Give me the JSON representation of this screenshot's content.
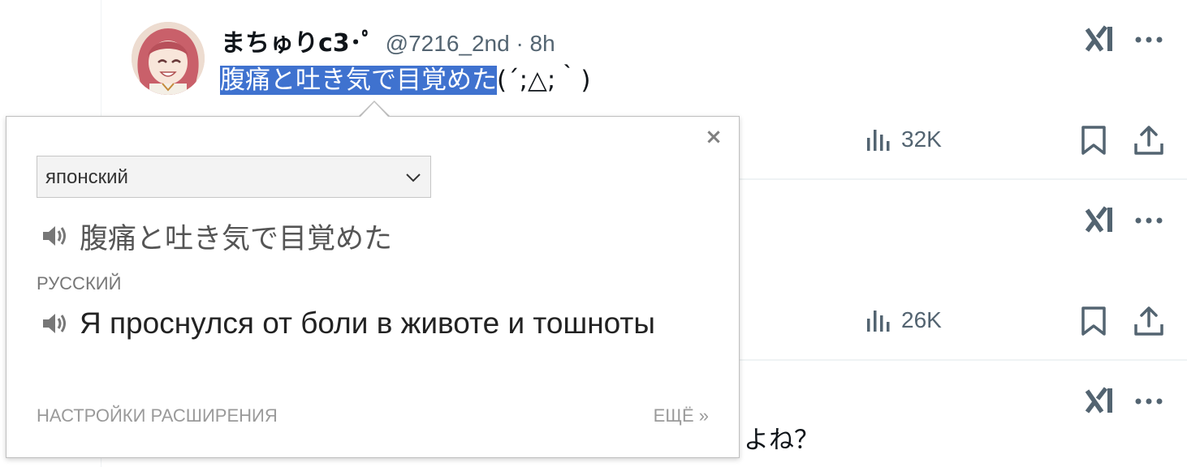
{
  "tweets": [
    {
      "author_name": "まちゅりc3･ﾟ",
      "handle_time": "@7216_2nd · 8h",
      "text_selected": "腹痛と吐き気で目覚めた",
      "text_rest": "(´;△;｀)",
      "views": "32K",
      "avatar": "avatar-anime-girl-pink-hair"
    },
    {
      "views": "26K"
    },
    {
      "text_fragment": "よね？"
    }
  ],
  "icons": {
    "grok": "xai-grok-icon",
    "more": "more-icon",
    "views": "bar-chart-icon",
    "bookmark": "bookmark-icon",
    "share": "share-icon",
    "speaker": "speaker-icon",
    "close": "close-icon",
    "chevron": "chevron-down-icon"
  },
  "translator": {
    "close_label": "×",
    "source_language": "японский",
    "source_text": "腹痛と吐き気で目覚めた",
    "target_language_label": "РУССКИЙ",
    "target_text": "Я проснулся от боли в животе и тошноты",
    "settings_link": "НАСТРОЙКИ РАСШИРЕНИЯ",
    "more_link": "ЕЩЁ »"
  },
  "colors": {
    "selection": "#3f72cf",
    "secondary_text": "#536471",
    "divider": "#eff3f4"
  }
}
